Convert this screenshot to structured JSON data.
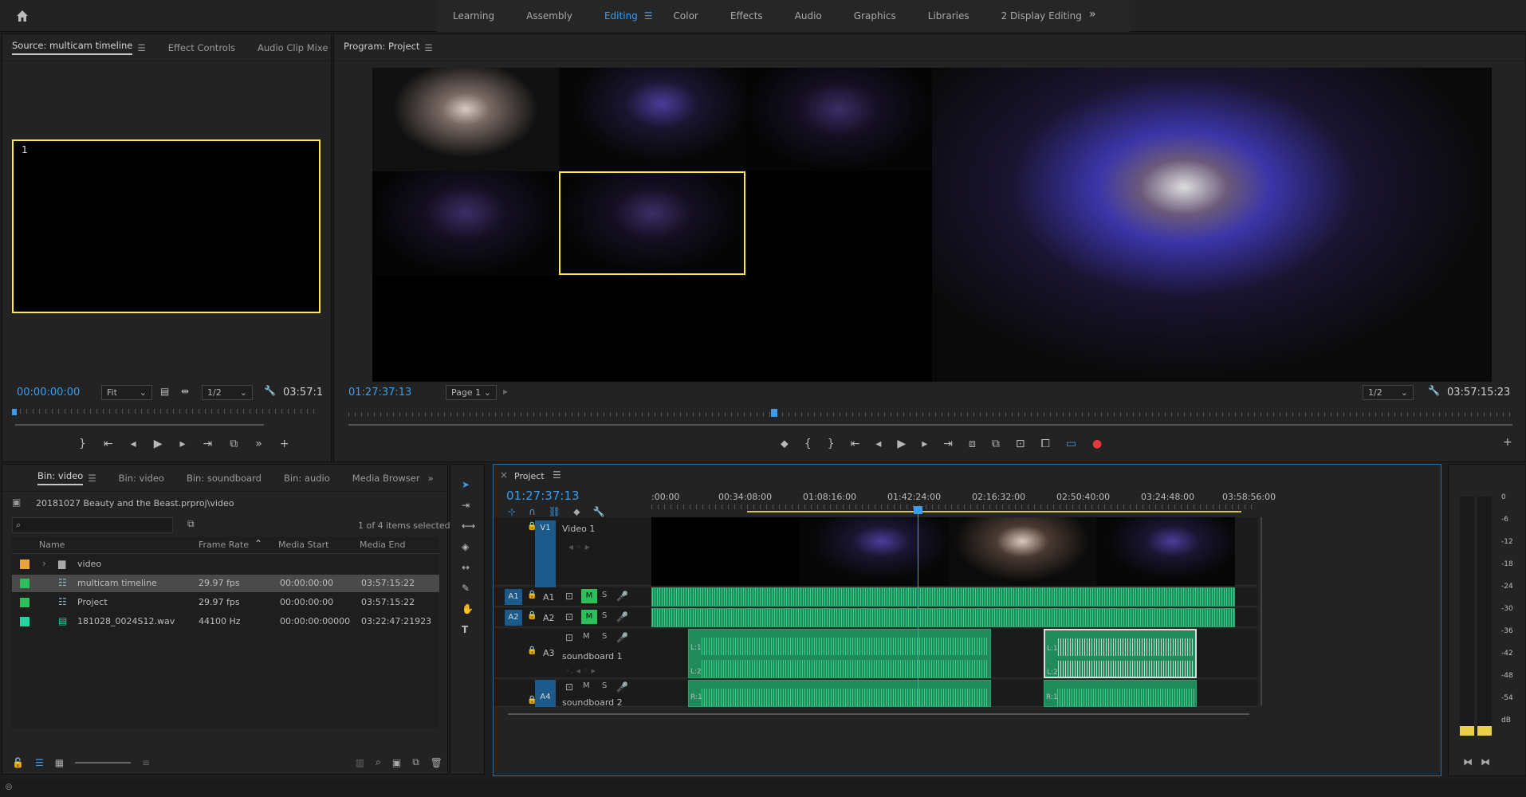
{
  "workspaces": {
    "tabs": [
      "Learning",
      "Assembly",
      "Editing",
      "Color",
      "Effects",
      "Audio",
      "Graphics",
      "Libraries",
      "2 Display Editing"
    ],
    "active": "Editing"
  },
  "source_panel": {
    "tabs": [
      "Source: multicam timeline",
      "Effect Controls",
      "Audio Clip Mixe"
    ],
    "angle_label": "1",
    "timecode": "00:00:00:00",
    "fit": "Fit",
    "resolution": "1/2",
    "duration": "03:57:1"
  },
  "program_panel": {
    "title": "Program: Project",
    "timecode": "01:27:37:13",
    "page": "Page 1",
    "resolution": "1/2",
    "duration": "03:57:15:23"
  },
  "project_panel": {
    "tabs": [
      "Bin: video",
      "Bin: video",
      "Bin: soundboard",
      "Bin: audio",
      "Media Browser"
    ],
    "path": "20181027 Beauty and the Beast.prproj\\video",
    "selection_status": "1 of 4 items selected",
    "columns": [
      "Name",
      "Frame Rate",
      "Media Start",
      "Media End"
    ],
    "rows": [
      {
        "name": "video",
        "frame_rate": "",
        "start": "",
        "end": "",
        "color": "#e8a33a"
      },
      {
        "name": "multicam timeline",
        "frame_rate": "29.97 fps",
        "start": "00:00:00:00",
        "end": "03:57:15:22",
        "color": "#2fbf5a"
      },
      {
        "name": "Project",
        "frame_rate": "29.97 fps",
        "start": "00:00:00:00",
        "end": "03:57:15:22",
        "color": "#2fbf5a"
      },
      {
        "name": "181028_0024S12.wav",
        "frame_rate": "44100 Hz",
        "start": "00:00:00:00000",
        "end": "03:22:47:21923",
        "color": "#2ad0a0"
      }
    ]
  },
  "timeline": {
    "title": "Project",
    "timecode": "01:27:37:13",
    "ruler_ticks": [
      ":00:00",
      "00:34:08:00",
      "01:08:16:00",
      "01:42:24:00",
      "02:16:32:00",
      "02:50:40:00",
      "03:24:48:00",
      "03:58:56:00"
    ],
    "tracks": {
      "v1": {
        "id": "V1",
        "name": "Video 1"
      },
      "a1": {
        "src": "A1",
        "id": "A1"
      },
      "a2": {
        "src": "A2",
        "id": "A2"
      },
      "a3": {
        "id": "A3",
        "name": "soundboard 1"
      },
      "a4": {
        "id": "A4",
        "name": "soundboard 2"
      }
    },
    "clip_labels": {
      "l1": "L:1",
      "l2": "L:2",
      "r1": "R:1",
      "l1b": "L:1",
      "l2b": "L:2",
      "r1b": "R:1"
    }
  },
  "meter_scale": [
    "0",
    "-6",
    "-12",
    "-18",
    "-24",
    "-30",
    "-36",
    "-42",
    "-48",
    "-54",
    "dB"
  ]
}
